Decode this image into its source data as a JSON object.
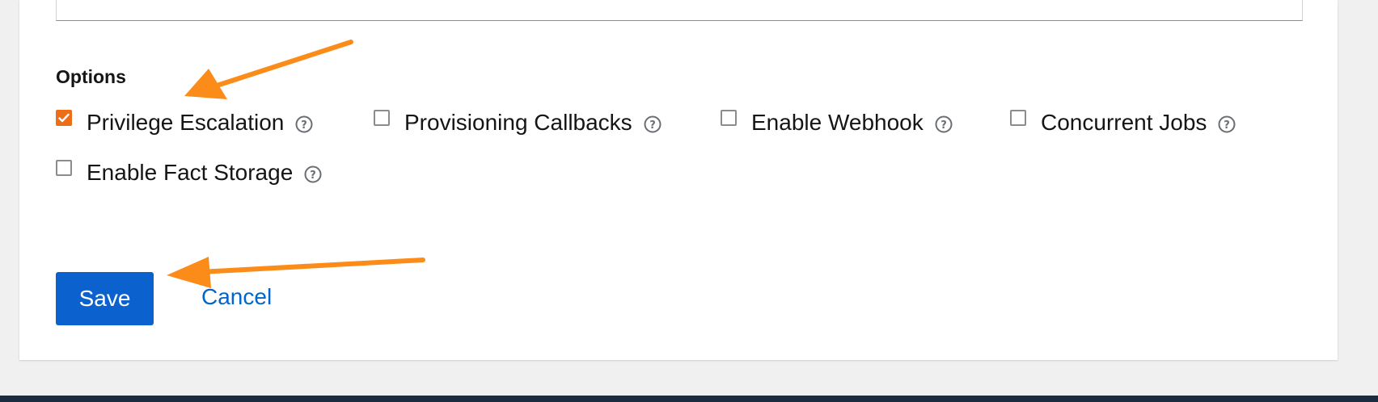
{
  "options": {
    "title": "Options",
    "items": [
      {
        "label": "Privilege Escalation",
        "checked": true,
        "help_icon": "question-circle-icon"
      },
      {
        "label": "Provisioning Callbacks",
        "checked": false,
        "help_icon": "question-circle-icon"
      },
      {
        "label": "Enable Webhook",
        "checked": false,
        "help_icon": "question-circle-icon"
      },
      {
        "label": "Concurrent Jobs",
        "checked": false,
        "help_icon": "question-circle-icon"
      },
      {
        "label": "Enable Fact Storage",
        "checked": false,
        "help_icon": "question-circle-icon"
      }
    ]
  },
  "actions": {
    "save_label": "Save",
    "cancel_label": "Cancel"
  },
  "colors": {
    "checkbox_checked": "#ee6d17",
    "primary_button": "#0b61cd",
    "link": "#0066cc",
    "annotation_arrow": "#fb8c19",
    "footer": "#1b2c3e"
  }
}
